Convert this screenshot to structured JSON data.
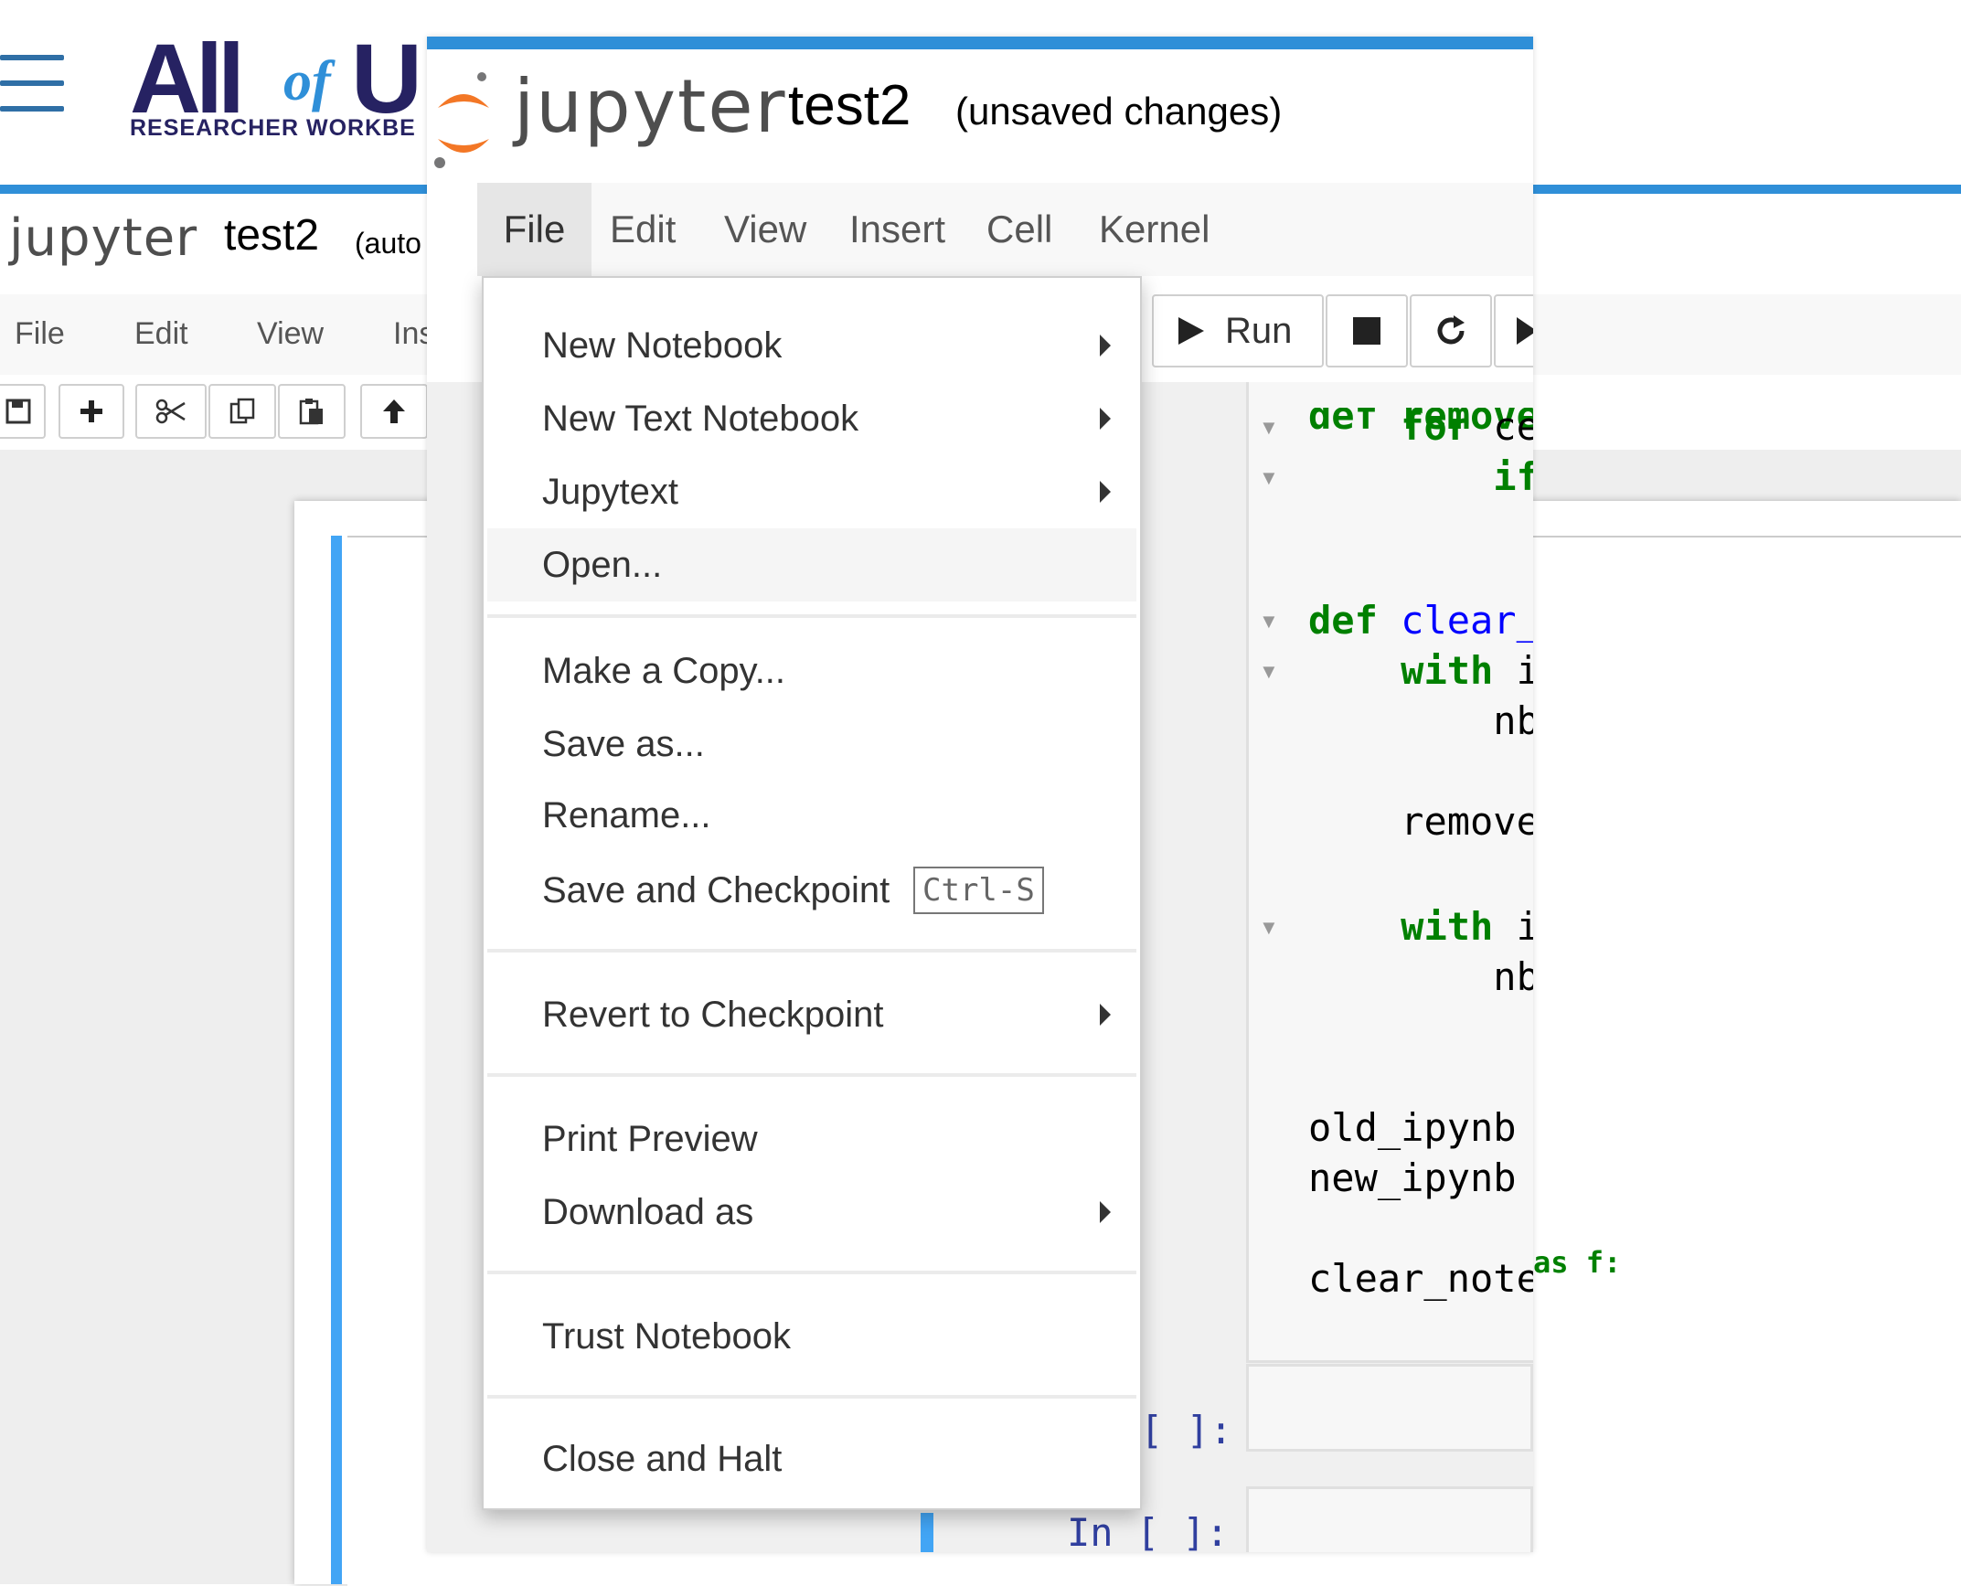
{
  "background": {
    "logo": {
      "line1": "All",
      "of": "of",
      "u": "U",
      "subtitle": "RESEARCHER WORKBE"
    },
    "jupyter_name": "jupyter",
    "notebook_name": "test2",
    "autosave": "(auto",
    "menu": [
      "File",
      "Edit",
      "View",
      "Ins"
    ],
    "overflow_code": "as f:"
  },
  "front": {
    "jupyter_name": "jupyter",
    "notebook_name": "test2",
    "status": "(unsaved changes)",
    "menu": [
      {
        "label": "File",
        "active": true
      },
      {
        "label": "Edit",
        "active": false
      },
      {
        "label": "View",
        "active": false
      },
      {
        "label": "Insert",
        "active": false
      },
      {
        "label": "Cell",
        "active": false
      },
      {
        "label": "Kernel",
        "active": false
      }
    ],
    "toolbar": {
      "run_label": "Run"
    },
    "code": {
      "l1_kw": "for",
      "l1": " ce",
      "l2_kw": "if",
      "l3_kw": "def",
      "l3_fn": "clear_",
      "l4_kw": "with",
      "l4": " i",
      "l5": "nb",
      "l6": "remove",
      "l7_kw": "with",
      "l7": " i",
      "l8": "nb",
      "l9": "old_ipynb",
      "l10": "new_ipynb",
      "l11": "clear_note",
      "top_partial": "def remove_"
    },
    "prompts": {
      "p1": "[ ]:",
      "p2": "In [ ]:"
    }
  },
  "file_menu": {
    "items": [
      {
        "label": "New Notebook",
        "submenu": true
      },
      {
        "label": "New Text Notebook",
        "submenu": true
      },
      {
        "label": "Jupytext",
        "submenu": true
      },
      {
        "label": "Open...",
        "submenu": false,
        "hover": true
      },
      {
        "label": "Make a Copy...",
        "submenu": false
      },
      {
        "label": "Save as...",
        "submenu": false
      },
      {
        "label": "Rename...",
        "submenu": false
      },
      {
        "label": "Save and Checkpoint",
        "submenu": false,
        "shortcut": "Ctrl-S"
      },
      {
        "label": "Revert to Checkpoint",
        "submenu": true
      },
      {
        "label": "Print Preview",
        "submenu": false
      },
      {
        "label": "Download as",
        "submenu": true
      },
      {
        "label": "Trust Notebook",
        "submenu": false
      },
      {
        "label": "Close and Halt",
        "submenu": false
      }
    ]
  },
  "icons": [
    "hamburger-icon",
    "save-icon",
    "plus-icon",
    "scissors-icon",
    "copy-icon",
    "paste-icon",
    "arrow-up-icon",
    "play-icon",
    "stop-icon",
    "restart-icon",
    "fast-forward-icon",
    "caret-right-icon",
    "fold-caret-icon"
  ],
  "colors": {
    "accent_blue": "#2f8fd8",
    "aou_navy": "#262262",
    "keyword_green": "#008000",
    "function_blue": "#0000ff",
    "prompt_blue": "#303f9f",
    "jupyter_orange": "#f37726"
  }
}
